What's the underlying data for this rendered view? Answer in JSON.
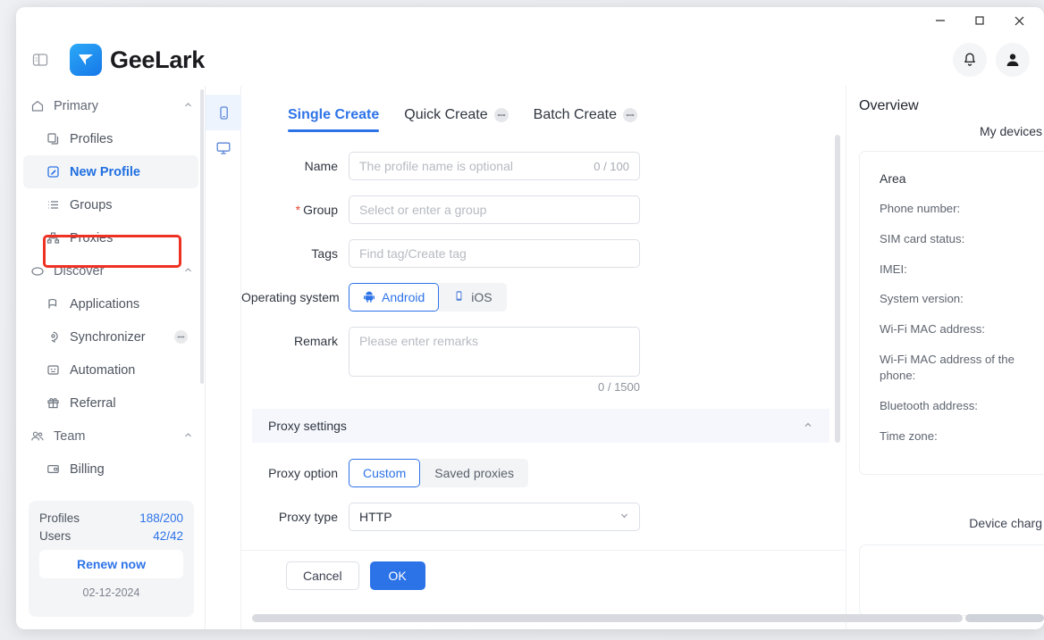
{
  "window": {
    "controls": {
      "minimize": "minimize-button",
      "maximize": "maximize-button",
      "close": "close-button"
    }
  },
  "header": {
    "brand_name": "GeeLark",
    "panel_toggle_icon": "panel-toggle-icon",
    "notification_icon": "bell-icon",
    "avatar_icon": "user-avatar-icon"
  },
  "sidebar": {
    "groups": [
      {
        "label": "Primary",
        "icon": "home-icon",
        "chevron": "chevron-up-icon",
        "items": [
          {
            "label": "Profiles",
            "icon": "profiles-icon",
            "active": false,
            "badge": null
          },
          {
            "label": "New Profile",
            "icon": "new-profile-icon",
            "active": true,
            "badge": null
          },
          {
            "label": "Groups",
            "icon": "groups-list-icon",
            "active": false,
            "badge": null
          },
          {
            "label": "Proxies",
            "icon": "proxies-icon",
            "active": false,
            "badge": null
          }
        ]
      },
      {
        "label": "Discover",
        "icon": "discover-cloud-icon",
        "chevron": "chevron-up-icon",
        "items": [
          {
            "label": "Applications",
            "icon": "applications-icon",
            "active": false,
            "badge": null
          },
          {
            "label": "Synchronizer",
            "icon": "synchronizer-icon",
            "active": false,
            "badge": "badge-icon"
          },
          {
            "label": "Automation",
            "icon": "automation-icon",
            "active": false,
            "badge": null
          },
          {
            "label": "Referral",
            "icon": "referral-gift-icon",
            "active": false,
            "badge": null
          }
        ]
      },
      {
        "label": "Team",
        "icon": "team-people-icon",
        "chevron": "chevron-up-icon",
        "items": [
          {
            "label": "Billing",
            "icon": "billing-card-icon",
            "active": false,
            "badge": null
          }
        ]
      }
    ],
    "plan": {
      "profiles_label": "Profiles",
      "profiles_value": "188/200",
      "users_label": "Users",
      "users_value": "42/42",
      "renew_label": "Renew now",
      "date": "02-12-2024"
    }
  },
  "icon_rail": {
    "items": [
      {
        "name": "phone-device-icon",
        "selected": true
      },
      {
        "name": "desktop-device-icon",
        "selected": false
      }
    ]
  },
  "main": {
    "tabs": [
      {
        "label": "Single Create",
        "active": true,
        "badge": null
      },
      {
        "label": "Quick Create",
        "active": false,
        "badge": "badge-icon"
      },
      {
        "label": "Batch Create",
        "active": false,
        "badge": "badge-icon"
      }
    ],
    "form": {
      "name": {
        "label": "Name",
        "placeholder": "The profile name is optional",
        "value": "",
        "counter": "0 / 100"
      },
      "group": {
        "label": "Group",
        "required": true,
        "placeholder": "Select or enter a group",
        "value": ""
      },
      "tags": {
        "label": "Tags",
        "placeholder": "Find tag/Create tag",
        "value": ""
      },
      "operating_system": {
        "label": "Operating system",
        "options": [
          {
            "label": "Android",
            "icon": "android-icon",
            "selected": true
          },
          {
            "label": "iOS",
            "icon": "ios-phone-icon",
            "selected": false
          }
        ]
      },
      "remark": {
        "label": "Remark",
        "placeholder": "Please enter remarks",
        "value": "",
        "counter": "0 / 1500"
      }
    },
    "proxy": {
      "section_title": "Proxy settings",
      "collapse_icon": "chevron-up-icon",
      "option": {
        "label": "Proxy option",
        "choices": [
          {
            "label": "Custom",
            "selected": true
          },
          {
            "label": "Saved proxies",
            "selected": false
          }
        ]
      },
      "type": {
        "label": "Proxy type",
        "value": "HTTP",
        "chevron": "chevron-down-icon"
      }
    },
    "footer": {
      "cancel_label": "Cancel",
      "ok_label": "OK"
    }
  },
  "overview": {
    "title": "Overview",
    "subtitle": "My devices",
    "area_label": "Area",
    "fields": [
      "Phone number:",
      "SIM card status:",
      "IMEI:",
      "System version:",
      "Wi-Fi MAC address:",
      "Wi-Fi MAC address of the phone:",
      "Bluetooth address:",
      "Time zone:"
    ],
    "device_charge_label": "Device charg"
  },
  "colors": {
    "accent": "#2d73e8",
    "highlight": "#ef3124",
    "panel_bg": "#f4f5f7",
    "section_bg": "#f5f7fc"
  }
}
